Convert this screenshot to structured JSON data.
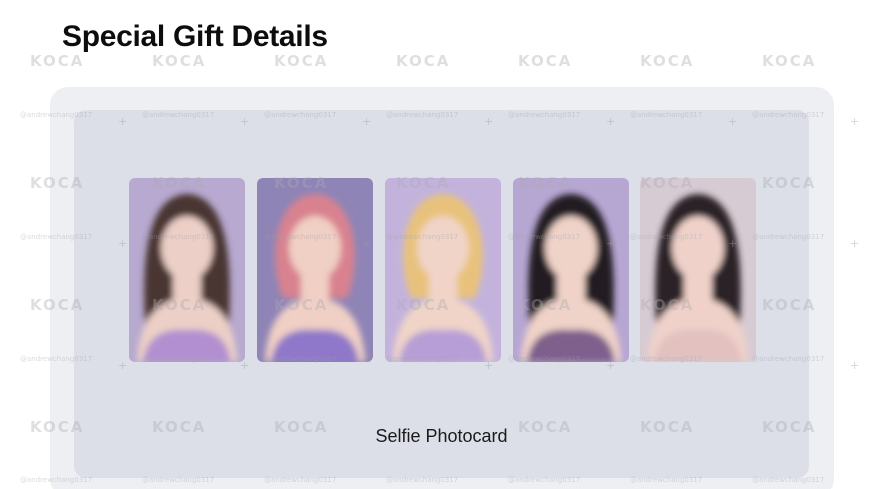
{
  "page": {
    "title": "Special Gift Details"
  },
  "gift": {
    "caption": "Selfie Photocard",
    "photocards": [
      {
        "label": "photocard 1",
        "background": "#b7a9cf",
        "hair": "#4a3430",
        "skin": "#eccfc6",
        "outfit": "#b28fd0"
      },
      {
        "label": "photocard 2",
        "background": "#8f84b6",
        "hair": "#d9828f",
        "skin": "#f0cfc4",
        "outfit": "#8f78c9"
      },
      {
        "label": "photocard 3",
        "background": "#c3b3dc",
        "hair": "#e8c27c",
        "skin": "#f0d4c7",
        "outfit": "#b79ed6"
      },
      {
        "label": "photocard 4",
        "background": "#b6a6d2",
        "hair": "#231d22",
        "skin": "#efd2c8",
        "outfit": "#7f5f8c"
      },
      {
        "label": "photocard 5",
        "background": "#d7cbd3",
        "hair": "#2a2226",
        "skin": "#efd1c9",
        "outfit": "#e2c1bf"
      }
    ]
  },
  "watermark": {
    "logo": "KOCA",
    "handle": "@andrewchang0317"
  },
  "colors": {
    "outer_panel": "#eeeff3",
    "inner_panel": "#dcdfe7",
    "title": "#0d0d0d"
  }
}
